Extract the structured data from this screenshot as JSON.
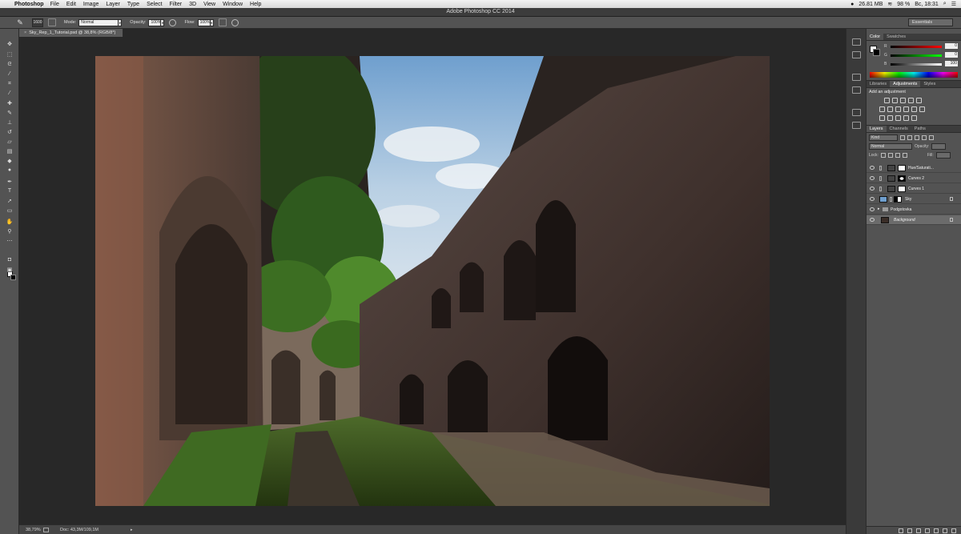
{
  "menubar": {
    "apple_icon": "apple-icon",
    "app_name": "Photoshop",
    "items": [
      "File",
      "Edit",
      "Image",
      "Layer",
      "Type",
      "Select",
      "Filter",
      "3D",
      "View",
      "Window",
      "Help"
    ],
    "memory": "26.81 MB",
    "battery": "98 %",
    "clock": "Вс, 18:31"
  },
  "window": {
    "title": "Adobe Photoshop CC 2014"
  },
  "options": {
    "brush_size": "1600",
    "mode_label": "Mode:",
    "mode_value": "Normal",
    "opacity_label": "Opacity:",
    "opacity_value": "100%",
    "flow_label": "Flow:",
    "flow_value": "100%",
    "workspace": "Essentials"
  },
  "document": {
    "tab_title": "Sky_Rep_1_Tutorial.psd @ 38,8% (RGB/8*)",
    "zoom": "38,79%",
    "doc_size": "Doc: 43,3M/109,1M"
  },
  "panels": {
    "color_tabs": [
      "Color",
      "Swatches"
    ],
    "rgb": [
      {
        "channel": "R",
        "value": "0"
      },
      {
        "channel": "G",
        "value": "0"
      },
      {
        "channel": "B",
        "value": "100"
      }
    ],
    "adj_tabs": [
      "Libraries",
      "Adjustments",
      "Styles"
    ],
    "adj_heading": "Add an adjustment",
    "layer_tabs": [
      "Layers",
      "Channels",
      "Paths"
    ],
    "filter_kind": "Kind",
    "blend_mode": "Normal",
    "opacity_label": "Opacity:",
    "fill_label": "Fill:",
    "lock_label": "Lock:",
    "layers": [
      {
        "name": "Hue/Saturati...",
        "type": "adjustment"
      },
      {
        "name": "Curves 2",
        "type": "adjustment"
      },
      {
        "name": "Curves 1",
        "type": "adjustment"
      },
      {
        "name": "Sky",
        "type": "pixel"
      },
      {
        "name": "Podgotovka",
        "type": "group"
      },
      {
        "name": "Background",
        "type": "background"
      }
    ]
  },
  "colors": {
    "ui_dark": "#282828",
    "ui_panel": "#535353",
    "accent": "#ffffff"
  }
}
